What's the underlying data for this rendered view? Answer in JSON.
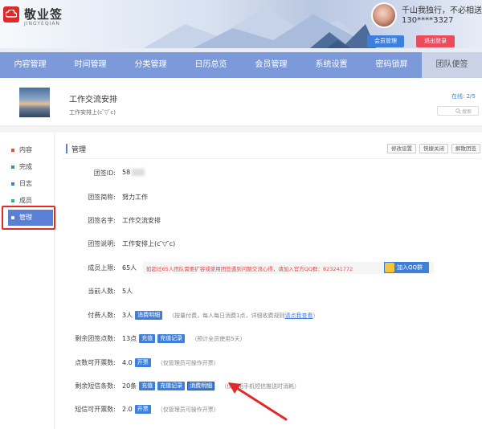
{
  "header": {
    "logo_text": "敬业签",
    "logo_sub": "JINGYEQIAN",
    "motto": "千山我独行，不必相送",
    "phone": "130****3327",
    "member_btn": "会员管理",
    "logout_btn": "退出登录"
  },
  "nav": {
    "items": [
      "内容管理",
      "时间管理",
      "分类管理",
      "日历总览",
      "会员管理",
      "系统设置",
      "密码锁屏",
      "团队便签"
    ],
    "active_index": 7
  },
  "group": {
    "name": "工作交流安排",
    "desc": "工作安排上(c ̄▽ ̄c)",
    "online": "在线: 2/5",
    "search_placeholder": "搜索"
  },
  "sidebar": {
    "items": [
      {
        "label": "内容",
        "color": "#e74c3c"
      },
      {
        "label": "完成",
        "color": "#3f7fdc"
      },
      {
        "label": "日志",
        "color": "#3f7fdc"
      },
      {
        "label": "成员",
        "color": "#2bbf6a"
      },
      {
        "label": "管理",
        "color": "#ffffff"
      }
    ],
    "active_index": 4
  },
  "main": {
    "title": "管理",
    "tools": [
      "修改设置",
      "快捷关闭",
      "解散团签"
    ],
    "rows": {
      "id": {
        "label": "团签ID:",
        "value": "58"
      },
      "short": {
        "label": "团签简称:",
        "value": "努力工作"
      },
      "name": {
        "label": "团签名字:",
        "value": "工作交流安排"
      },
      "desc": {
        "label": "团签说明:",
        "value": "工作安排上(c ̄▽ ̄c)"
      },
      "limit": {
        "label": "成员上限:",
        "value": "65人",
        "warn": "如超过65人团队需要扩容或使用团签遇到问题交流心得，请加入官方QQ群：823241772",
        "qq_btn": "加入QQ群"
      },
      "current": {
        "label": "当前人数:",
        "value": "5人"
      },
      "paid": {
        "label": "付费人数:",
        "value": "3人",
        "btn": "消费明细",
        "note": "（按量付费，每人每日消费1点，详细收费规则",
        "link": "请点我查看",
        "note_end": "）"
      },
      "points": {
        "label": "剩余团签点数:",
        "value": "13点",
        "btn1": "充值",
        "btn2": "充值记录",
        "note": "（预计全员使用5天）"
      },
      "invoice": {
        "label": "点数可开票数:",
        "value": "4.0",
        "btn": "开票",
        "note": "（仅管理员可操作开票）"
      },
      "sms": {
        "label": "剩余短信条数:",
        "value": "20条",
        "btn1": "充值",
        "btn2": "充值记录",
        "btn3": "消费明细",
        "note": "（仅使用手机短信推送时消耗）"
      },
      "sms_invoice": {
        "label": "短信可开票数:",
        "value": "2.0",
        "btn": "开票",
        "note": "（仅管理员可操作开票）"
      }
    }
  },
  "colors": {
    "accent": "#3f7fdc",
    "nav": "#7c9ad9",
    "annotation": "#e32a2a"
  }
}
